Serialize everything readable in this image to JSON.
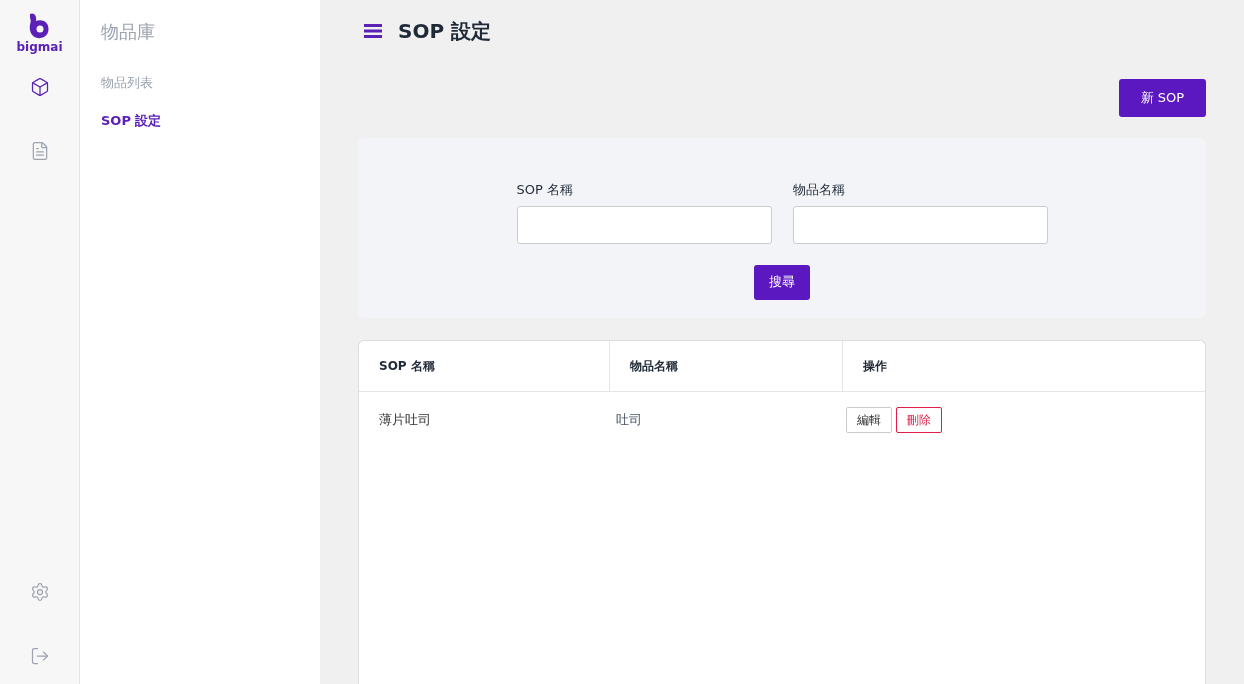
{
  "logo": {
    "text": "bigmai"
  },
  "rail": [
    {
      "kind": "box",
      "selected": true
    },
    {
      "kind": "document",
      "selected": false
    }
  ],
  "rail_bottom": [
    {
      "kind": "settings"
    },
    {
      "kind": "logout"
    }
  ],
  "sidebar": {
    "title": "物品庫",
    "items": [
      {
        "label": "物品列表",
        "selected": false
      },
      {
        "label": "SOP 設定",
        "selected": true
      }
    ]
  },
  "page": {
    "title": "SOP 設定",
    "new_button": "新 SOP"
  },
  "search": {
    "fields": [
      {
        "label": "SOP 名稱"
      },
      {
        "label": "物品名稱"
      }
    ],
    "button": "搜尋"
  },
  "table": {
    "columns": [
      "SOP 名稱",
      "物品名稱",
      "操作"
    ],
    "rows": [
      {
        "sop": "薄片吐司",
        "item": "吐司",
        "actions": [
          {
            "kind": "edit",
            "label": "編輯"
          },
          {
            "kind": "delete",
            "label": "刪除"
          }
        ]
      }
    ]
  }
}
